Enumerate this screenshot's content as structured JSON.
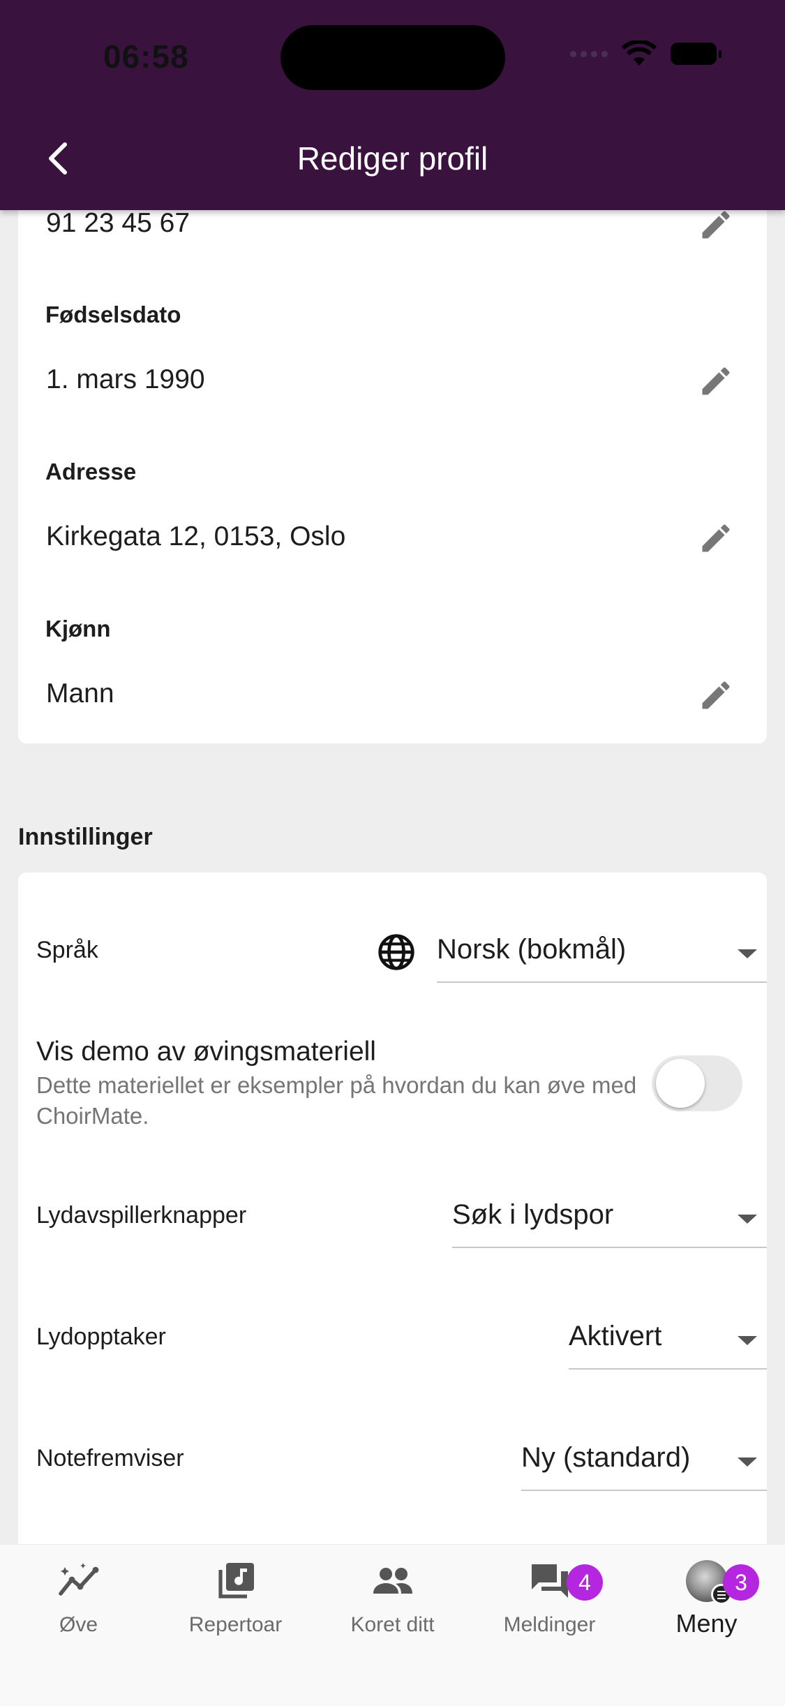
{
  "status_bar": {
    "time": "06:58"
  },
  "header": {
    "title": "Rediger profil"
  },
  "profile": {
    "phone_value": "91 23 45 67",
    "fields": [
      {
        "label": "Fødselsdato",
        "value": "1. mars 1990"
      },
      {
        "label": "Adresse",
        "value": "Kirkegata 12, 0153, Oslo"
      },
      {
        "label": "Kjønn",
        "value": "Mann"
      }
    ]
  },
  "settings": {
    "section_title": "Innstillinger",
    "language": {
      "label": "Språk",
      "value": "Norsk (bokmål)"
    },
    "demo": {
      "title": "Vis demo av øvingsmateriell",
      "subtitle": "Dette materiellet er eksempler på hvordan du kan øve med ChoirMate.",
      "enabled": false
    },
    "player_buttons": {
      "label": "Lydavspillerknapper",
      "value": "Søk i lydspor"
    },
    "recorder": {
      "label": "Lydopptaker",
      "value": "Aktivert"
    },
    "score_viewer": {
      "label": "Notefremviser",
      "value": "Ny (standard)"
    }
  },
  "bottom_nav": {
    "items": [
      {
        "label": "Øve",
        "icon": "practice-chart-icon"
      },
      {
        "label": "Repertoar",
        "icon": "music-library-icon"
      },
      {
        "label": "Koret ditt",
        "icon": "people-icon"
      },
      {
        "label": "Meldinger",
        "icon": "chat-icon",
        "badge": "4"
      },
      {
        "label": "Meny",
        "icon": "avatar",
        "badge": "3",
        "active": true
      }
    ]
  },
  "colors": {
    "appbar": "#3a123e",
    "badge": "#b526e0",
    "background": "#eeeeee"
  }
}
